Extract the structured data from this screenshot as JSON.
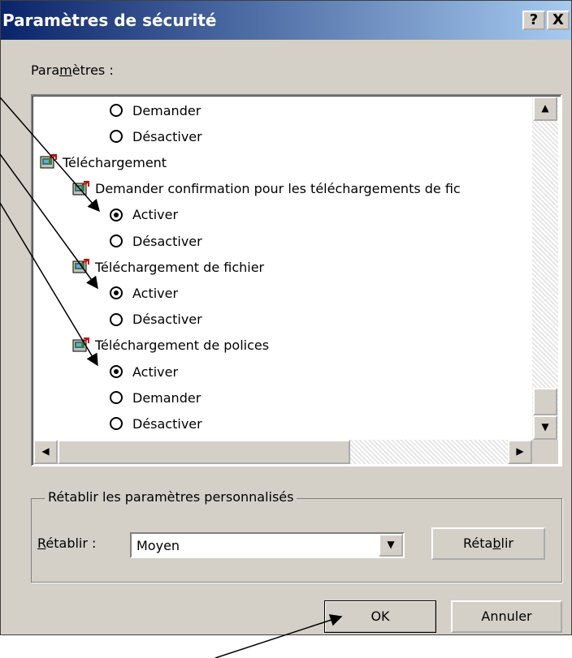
{
  "dialog": {
    "title": "Paramètres de sécurité",
    "help_label": "?",
    "close_label": "X"
  },
  "settings": {
    "label_prefix": "Para",
    "label_accel": "m",
    "label_suffix": "ètres :",
    "items": [
      {
        "type": "radio",
        "label": "Demander",
        "checked": false,
        "level": 2
      },
      {
        "type": "radio",
        "label": "Désactiver",
        "checked": false,
        "level": 2
      },
      {
        "type": "category",
        "label": "Téléchargement",
        "level": 0
      },
      {
        "type": "setting",
        "label": "Demander confirmation pour les téléchargements de fic",
        "level": 1
      },
      {
        "type": "radio",
        "label": "Activer",
        "checked": true,
        "level": 2
      },
      {
        "type": "radio",
        "label": "Désactiver",
        "checked": false,
        "level": 2
      },
      {
        "type": "setting",
        "label": "Téléchargement de fichier",
        "level": 1
      },
      {
        "type": "radio",
        "label": "Activer",
        "checked": true,
        "level": 2
      },
      {
        "type": "radio",
        "label": "Désactiver",
        "checked": false,
        "level": 2
      },
      {
        "type": "setting",
        "label": "Téléchargement de polices",
        "level": 1
      },
      {
        "type": "radio",
        "label": "Activer",
        "checked": true,
        "level": 2
      },
      {
        "type": "radio",
        "label": "Demander",
        "checked": false,
        "level": 2
      },
      {
        "type": "radio",
        "label": "Désactiver",
        "checked": false,
        "level": 2
      }
    ]
  },
  "reset": {
    "group_title": "Rétablir les paramètres personnalisés",
    "label_accel": "R",
    "label_suffix": "établir :",
    "selected": "Moyen",
    "button_prefix": "Réta",
    "button_accel": "b",
    "button_suffix": "lir"
  },
  "footer": {
    "ok_label": "OK",
    "cancel_label": "Annuler"
  }
}
